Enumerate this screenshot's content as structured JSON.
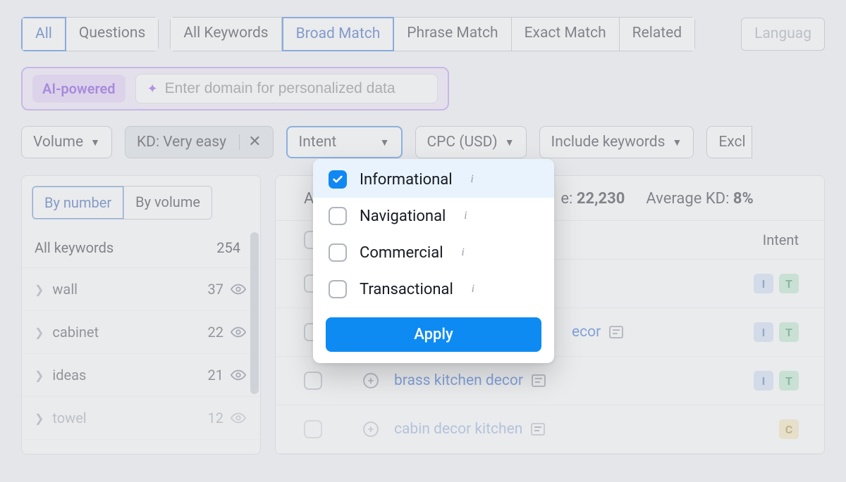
{
  "tabs": {
    "group1": [
      "All",
      "Questions"
    ],
    "group2": [
      "All Keywords",
      "Broad Match",
      "Phrase Match",
      "Exact Match",
      "Related"
    ],
    "selected_g1": "All",
    "selected_g2": "Broad Match",
    "extra": "Languag"
  },
  "ai": {
    "chip": "AI-powered",
    "placeholder": "Enter domain for personalized data"
  },
  "filters": {
    "volume": "Volume",
    "kd": "KD: Very easy",
    "intent": "Intent",
    "cpc": "CPC (USD)",
    "include": "Include keywords",
    "exclude": "Excl"
  },
  "intent_dropdown": {
    "options": [
      {
        "label": "Informational",
        "checked": true
      },
      {
        "label": "Navigational",
        "checked": false
      },
      {
        "label": "Commercial",
        "checked": false
      },
      {
        "label": "Transactional",
        "checked": false
      }
    ],
    "apply": "Apply"
  },
  "sidebar": {
    "tab_number": "By number",
    "tab_volume": "By volume",
    "header_label": "All keywords",
    "header_count": "254",
    "items": [
      {
        "label": "wall",
        "count": "37"
      },
      {
        "label": "cabinet",
        "count": "22"
      },
      {
        "label": "ideas",
        "count": "21"
      },
      {
        "label": "towel",
        "count": "12"
      }
    ]
  },
  "summary": {
    "prefix_a": "A",
    "vol_label": "e:",
    "vol_value": "22,230",
    "kd_label": "Average KD:",
    "kd_value": "8%"
  },
  "table": {
    "col_intent": "Intent",
    "rows": [
      {
        "keyword": "",
        "badges": [
          "I",
          "T"
        ],
        "faded": false
      },
      {
        "keyword": "ecor",
        "badges": [
          "I",
          "T"
        ],
        "faded": false,
        "partial": true
      },
      {
        "keyword": "brass kitchen decor",
        "badges": [
          "I",
          "T"
        ],
        "faded": false
      },
      {
        "keyword": "cabin decor kitchen",
        "badges": [
          "C"
        ],
        "faded": true
      }
    ]
  }
}
